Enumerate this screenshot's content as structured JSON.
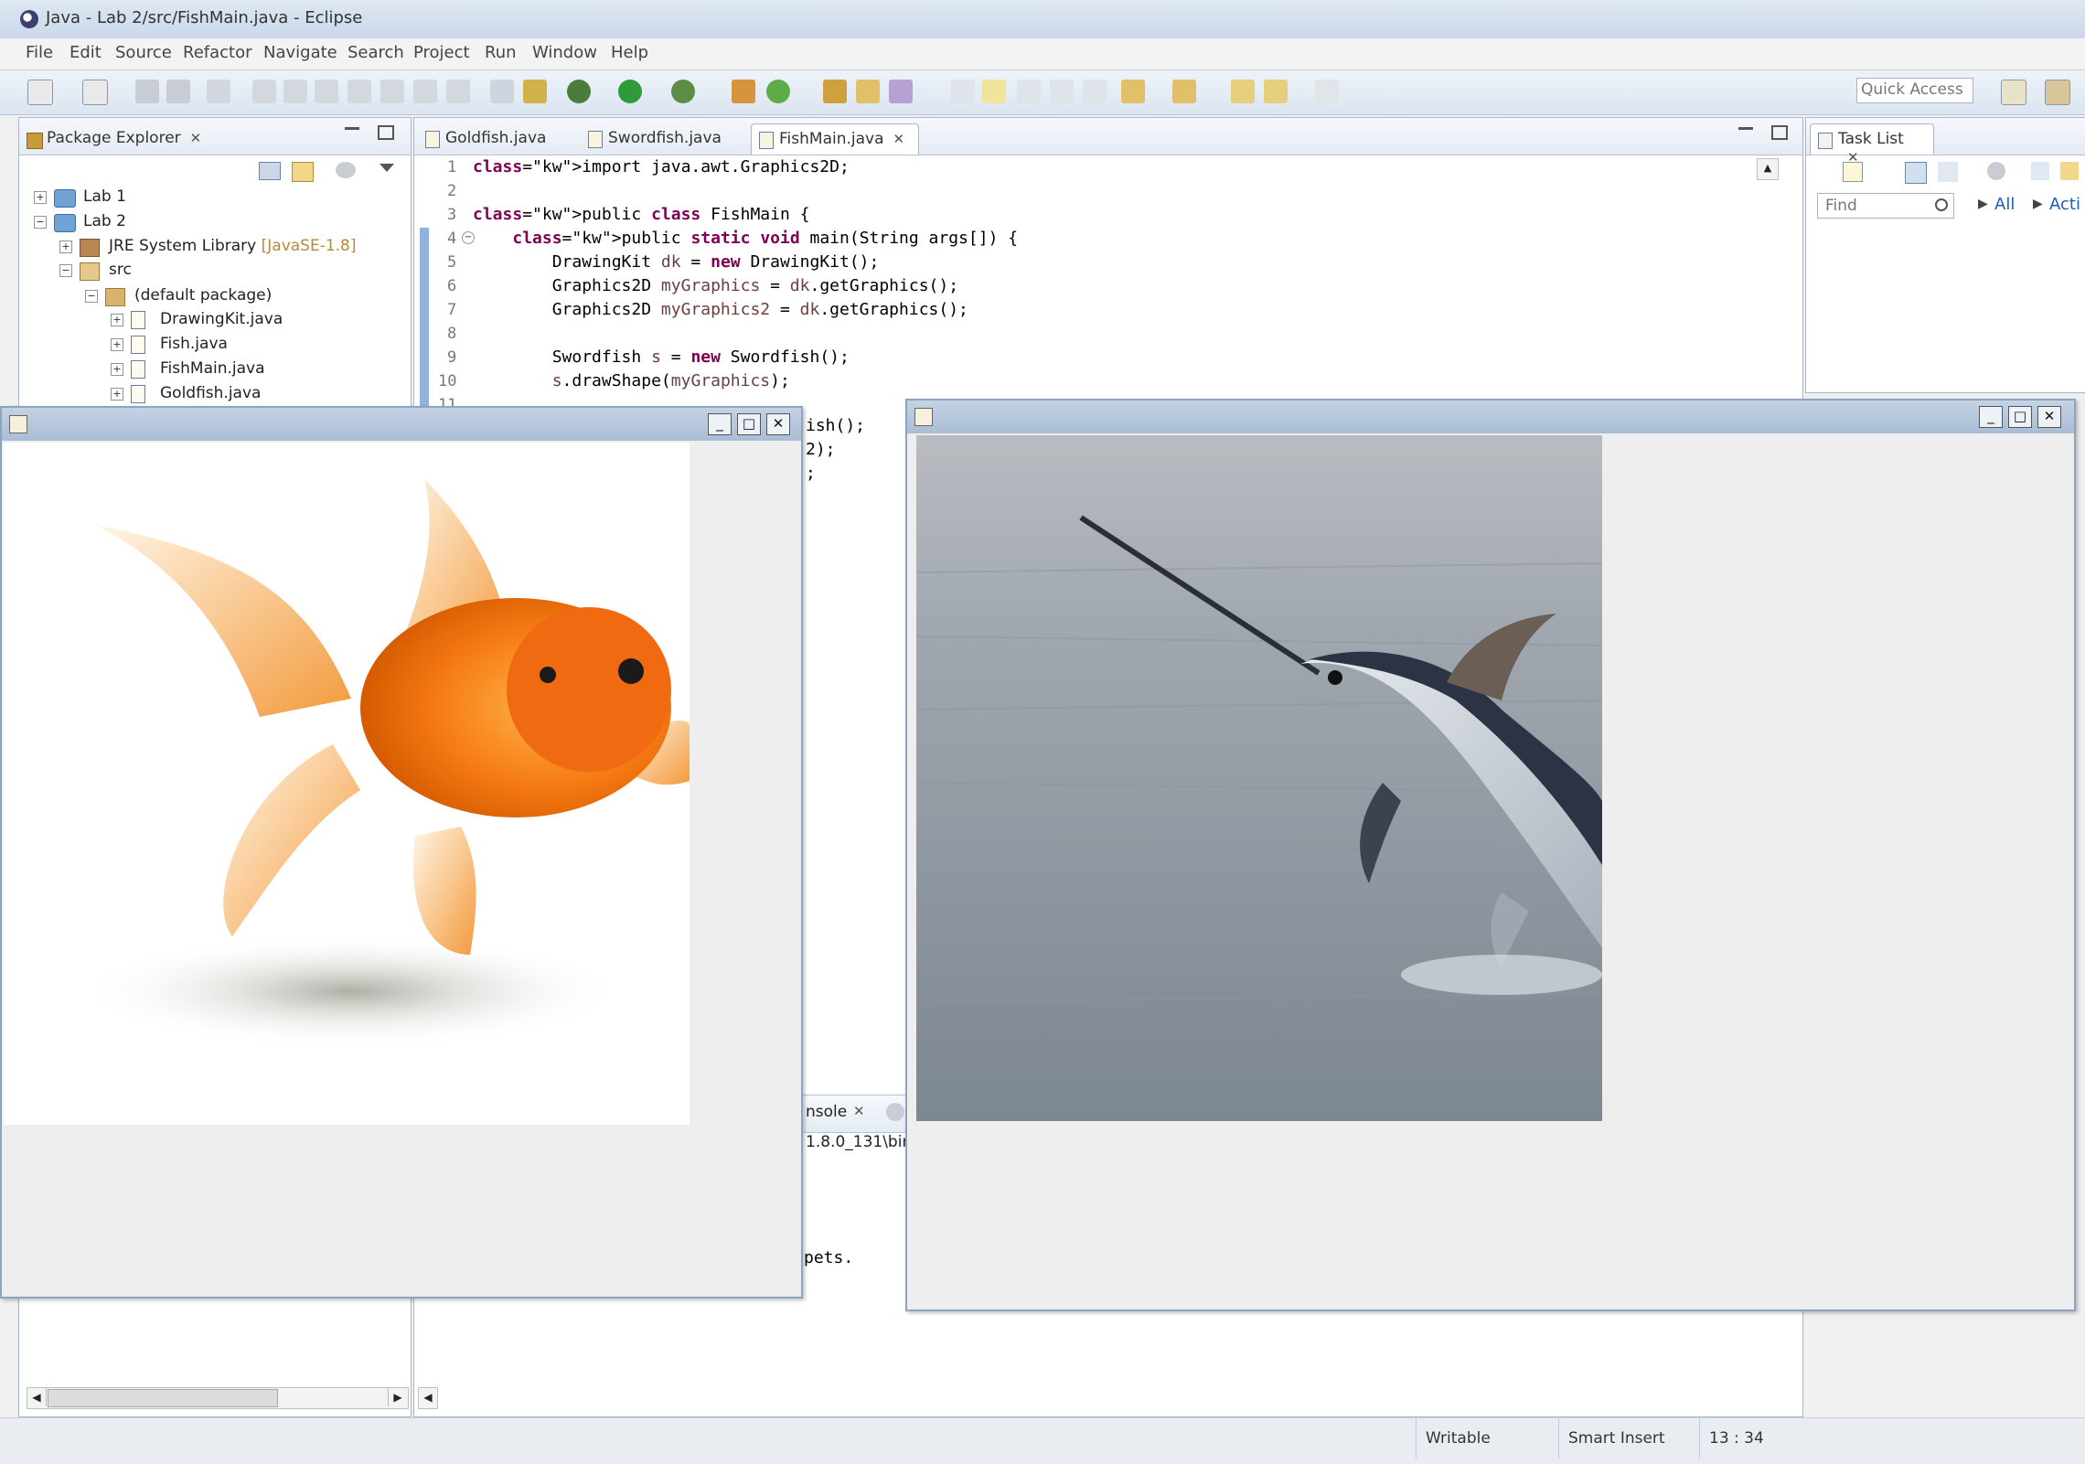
{
  "window": {
    "title": "Java - Lab 2/src/FishMain.java - Eclipse"
  },
  "menu": [
    "File",
    "Edit",
    "Source",
    "Refactor",
    "Navigate",
    "Search",
    "Project",
    "Run",
    "Window",
    "Help"
  ],
  "toolbar": {
    "quick_access_placeholder": "Quick Access"
  },
  "package_explorer": {
    "tab_label": "Package Explorer",
    "items": [
      {
        "label": "Lab 1"
      },
      {
        "label": "Lab 2"
      },
      {
        "label": "JRE System Library",
        "decoration": "[JavaSE-1.8]"
      },
      {
        "label": "src"
      },
      {
        "label": "(default package)"
      },
      {
        "label": "DrawingKit.java"
      },
      {
        "label": "Fish.java"
      },
      {
        "label": "FishMain.java"
      },
      {
        "label": "Goldfish.java"
      }
    ]
  },
  "editor": {
    "tabs": [
      {
        "label": "Goldfish.java",
        "active": false
      },
      {
        "label": "Swordfish.java",
        "active": false
      },
      {
        "label": "FishMain.java",
        "active": true
      }
    ],
    "line_numbers": [
      "1",
      "2",
      "3",
      "4",
      "5",
      "6",
      "7",
      "8",
      "9",
      "10",
      "11"
    ],
    "lines": [
      "import java.awt.Graphics2D;",
      "",
      "public class FishMain {",
      "    public static void main(String args[]) {",
      "        DrawingKit dk = new DrawingKit();",
      "        Graphics2D myGraphics = dk.getGraphics();",
      "        Graphics2D myGraphics2 = dk.getGraphics();",
      "",
      "        Swordfish s = new Swordfish();",
      "        s.drawShape(myGraphics);",
      ""
    ],
    "visible_fragments": [
      "ish();",
      "2);",
      ";"
    ]
  },
  "task_list": {
    "tab_label": "Task List",
    "find_placeholder": "Find",
    "all_label": "All",
    "activate_label": "Acti"
  },
  "console": {
    "tab_label": "nsole",
    "path_fragment": "1.8.0_131\\bin\\",
    "output_fragment": "pets."
  },
  "java_windows": {
    "left": {
      "subject": "goldfish image"
    },
    "right": {
      "subject": "swordfish image"
    }
  },
  "status": {
    "writable": "Writable",
    "insert_mode": "Smart Insert",
    "position": "13 : 34"
  },
  "colors": {
    "keyword": "#7f0055",
    "variable": "#6a3e3e",
    "decoration": "#b58a3b",
    "link": "#1d5fb8"
  }
}
